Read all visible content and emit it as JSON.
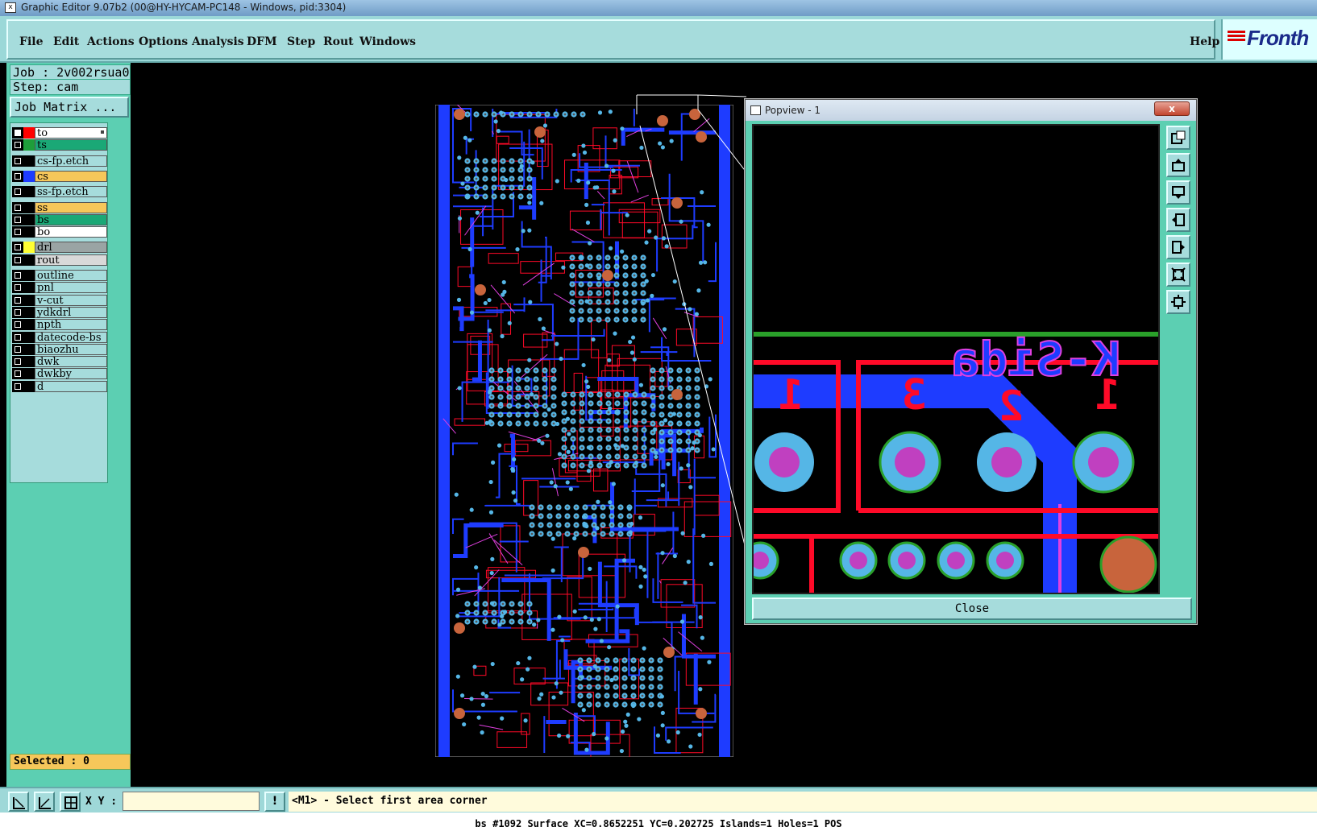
{
  "window": {
    "title": "Graphic Editor 9.07b2 (00@HY-HYCAM-PC148 - Windows, pid:3304)"
  },
  "menu": {
    "items": [
      {
        "label": "File"
      },
      {
        "label": "Edit"
      },
      {
        "label": "Actions"
      },
      {
        "label": "Options"
      },
      {
        "label": "Analysis"
      },
      {
        "label": "DFM"
      },
      {
        "label": "Step"
      },
      {
        "label": "Rout"
      },
      {
        "label": "Windows"
      }
    ],
    "help": "Help"
  },
  "logo": {
    "text": "Fronth"
  },
  "job": {
    "label": "Job : 2v002rsua0",
    "step": "Step: cam",
    "matrix_button": "Job Matrix ..."
  },
  "layers": [
    {
      "name": "to",
      "color": "#ff0000",
      "fill": "#ffffff",
      "on": true
    },
    {
      "name": "ts",
      "color": "#1e9e3a",
      "fill": "#1aa876",
      "on": false
    },
    {
      "name": "cs-fp.etch",
      "color": "#000000",
      "fill": "#a6dcdc",
      "on": false
    },
    {
      "name": "cs",
      "color": "#1e3cff",
      "fill": "#f6c75a",
      "on": false
    },
    {
      "name": "ss-fp.etch",
      "color": "#000000",
      "fill": "#a6dcdc",
      "on": false
    },
    {
      "name": "ss",
      "color": "#000000",
      "fill": "#f6c75a",
      "on": false
    },
    {
      "name": "bs",
      "color": "#000000",
      "fill": "#1aa876",
      "on": false
    },
    {
      "name": "bo",
      "color": "#000000",
      "fill": "#ffffff",
      "on": false
    },
    {
      "name": "drl",
      "color": "#ffff33",
      "fill": "#9aa4a4",
      "on": false
    },
    {
      "name": "rout",
      "color": "#000000",
      "fill": "#d8d8d8",
      "on": false
    },
    {
      "name": "outline",
      "color": "#000000",
      "fill": "#a6dcdc",
      "on": false
    },
    {
      "name": "pnl",
      "color": "#000000",
      "fill": "#a6dcdc",
      "on": false
    },
    {
      "name": "v-cut",
      "color": "#000000",
      "fill": "#a6dcdc",
      "on": false
    },
    {
      "name": "ydkdrl",
      "color": "#000000",
      "fill": "#a6dcdc",
      "on": false
    },
    {
      "name": "npth",
      "color": "#000000",
      "fill": "#a6dcdc",
      "on": false
    },
    {
      "name": "datecode-bs",
      "color": "#000000",
      "fill": "#a6dcdc",
      "on": false
    },
    {
      "name": "biaozhu",
      "color": "#000000",
      "fill": "#a6dcdc",
      "on": false
    },
    {
      "name": "dwk",
      "color": "#000000",
      "fill": "#a6dcdc",
      "on": false
    },
    {
      "name": "dwkby",
      "color": "#000000",
      "fill": "#a6dcdc",
      "on": false
    },
    {
      "name": "d",
      "color": "#000000",
      "fill": "#a6dcdc",
      "on": false
    }
  ],
  "selected": "Selected : 0",
  "bottom": {
    "xy_label": "X Y :",
    "xy_value": "",
    "excl": "!",
    "prompt": "<M1> - Select first area corner",
    "status": "bs #1092 Surface XC=0.8652251 YC=0.202725 Islands=1 Holes=1 POS"
  },
  "popview": {
    "title": "Popview - 1",
    "close_x": "x",
    "close_button": "Close",
    "text_mirror": "K-Sida",
    "pin_labels": [
      "1",
      "3",
      "2",
      "1"
    ]
  },
  "colors": {
    "panel": "#5ccfb2",
    "menu": "#a6dcdc",
    "trace_blue": "#1e3cff",
    "silk_red": "#ff0a28",
    "pad_cyan": "#55b6e6",
    "pad_magenta": "#c040c0",
    "copper": "#c8643c",
    "green_line": "#2aa02a"
  }
}
